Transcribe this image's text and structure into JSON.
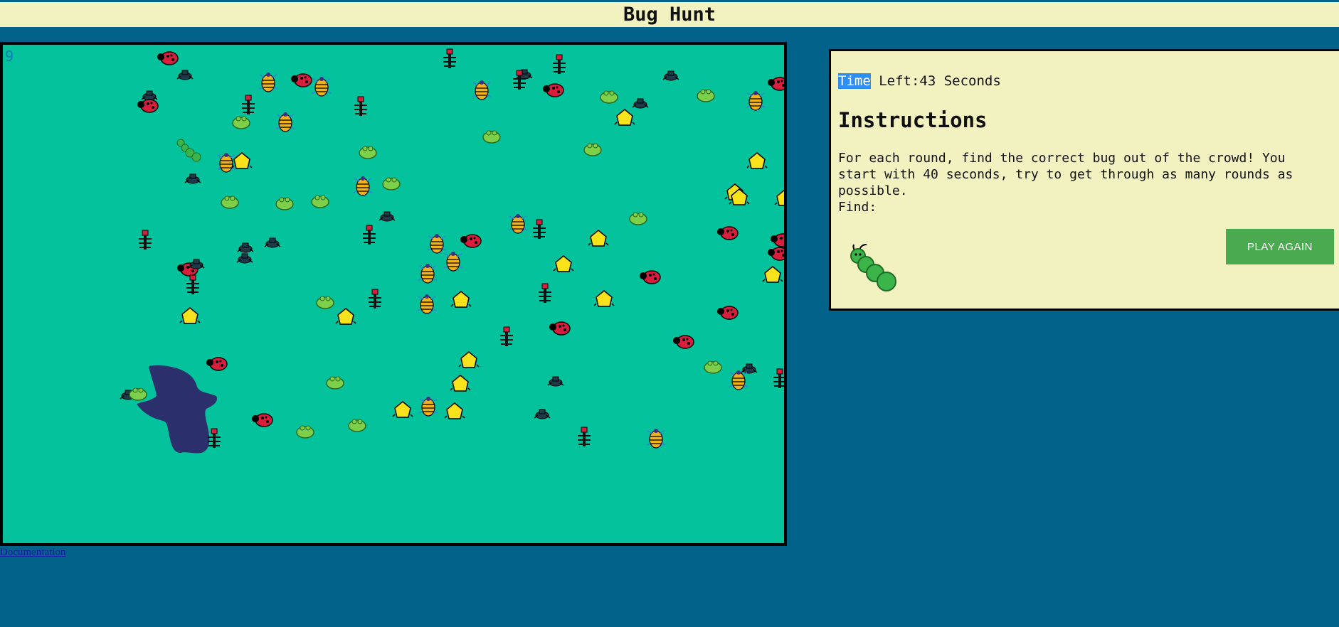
{
  "app": {
    "title": "Bug Hunt"
  },
  "game": {
    "round_number": "9"
  },
  "panel": {
    "timer": {
      "label_selected": "Time",
      "label_rest": " Left:43 Seconds"
    },
    "instructions_title": "Instructions",
    "instructions_text": "For each round, find the correct bug out of the crowd! You start with 40 seconds, try to get through as many rounds as possible.",
    "find_label": "Find:",
    "target_bug": "caterpillar",
    "play_again_label": "PLAY AGAIN"
  },
  "footer": {
    "documentation_link": "Documentation"
  },
  "colors": {
    "field": "#04c29b",
    "background": "#03628a",
    "panel": "#f1f2c0",
    "button": "#4aaa4f",
    "bird_shadow": "#2b2f6b"
  },
  "bug_types": [
    "ladybug",
    "beetle",
    "ant",
    "striped-bug",
    "frog-bug",
    "yellow-house-bug",
    "caterpillar"
  ]
}
